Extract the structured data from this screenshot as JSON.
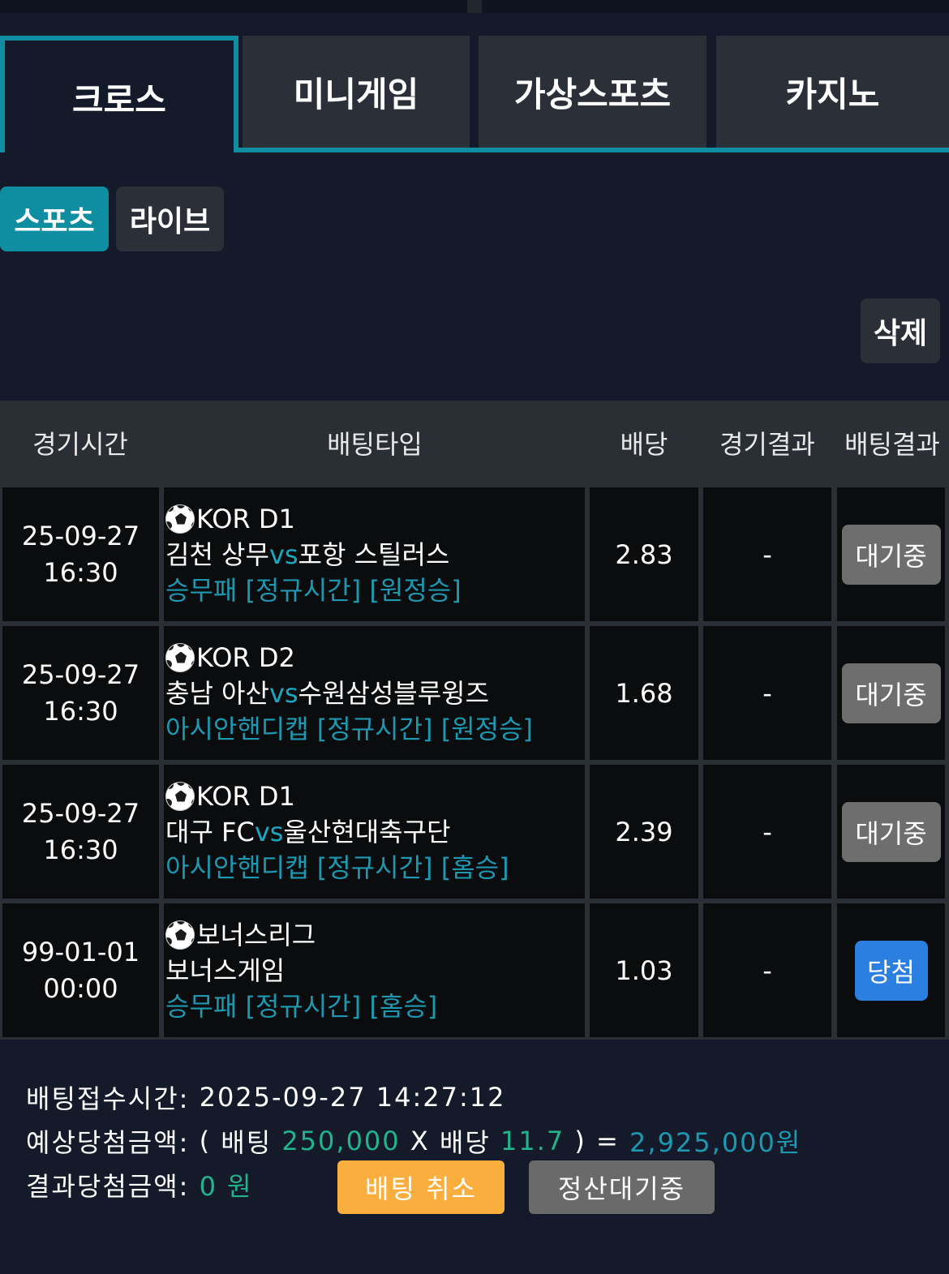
{
  "main_tabs": [
    {
      "label": "크로스",
      "active": true
    },
    {
      "label": "미니게임",
      "active": false
    },
    {
      "label": "가상스포츠",
      "active": false
    },
    {
      "label": "카지노",
      "active": false
    }
  ],
  "sub_tabs": [
    {
      "label": "스포츠",
      "active": true
    },
    {
      "label": "라이브",
      "active": false
    }
  ],
  "delete_label": "삭제",
  "table": {
    "headers": [
      "경기시간",
      "배팅타입",
      "배당",
      "경기결과",
      "배팅결과"
    ],
    "rows": [
      {
        "date": "25-09-27",
        "time": "16:30",
        "league": "KOR D1",
        "home": "김천 상무",
        "vs": "vs",
        "away": "포항 스틸러스",
        "pick": "승무패 [정규시간] [원정승]",
        "odds": "2.83",
        "result": "-",
        "status": "대기중"
      },
      {
        "date": "25-09-27",
        "time": "16:30",
        "league": "KOR D2",
        "home": "충남 아산",
        "vs": "vs",
        "away": "수원삼성블루윙즈",
        "pick": "아시안핸디캡 [정규시간] [원정승]",
        "odds": "1.68",
        "result": "-",
        "status": "대기중"
      },
      {
        "date": "25-09-27",
        "time": "16:30",
        "league": "KOR D1",
        "home": "대구 FC",
        "vs": "vs",
        "away": "울산현대축구단",
        "pick": "아시안핸디캡 [정규시간] [홈승]",
        "odds": "2.39",
        "result": "-",
        "status": "대기중"
      },
      {
        "date": "99-01-01",
        "time": "00:00",
        "league": "보너스리그",
        "home": "보너스게임",
        "vs": "",
        "away": "",
        "pick": "승무패 [정규시간] [홈승]",
        "odds": "1.03",
        "result": "-",
        "status": "당첨"
      }
    ]
  },
  "summary": {
    "received_label": "배팅접수시간:",
    "received_value": "2025-09-27 14:27:12",
    "expected_label": "예상당첨금액:",
    "open_paren": "(",
    "bet_word": "배팅",
    "bet_amount": "250,000",
    "times": "X",
    "odds_word": "배당",
    "total_odds": "11.7",
    "close_eq": ") =",
    "expected_amount": "2,925,000원",
    "result_label": "결과당첨금액:",
    "result_amount": "0 원",
    "cancel_label": "배팅 취소",
    "settle_label": "정산대기중"
  },
  "colors": {
    "accent": "#0e8ea0",
    "pending": "#6e6e6e",
    "win": "#2b7fe0",
    "cancel": "#f9ae3e"
  }
}
